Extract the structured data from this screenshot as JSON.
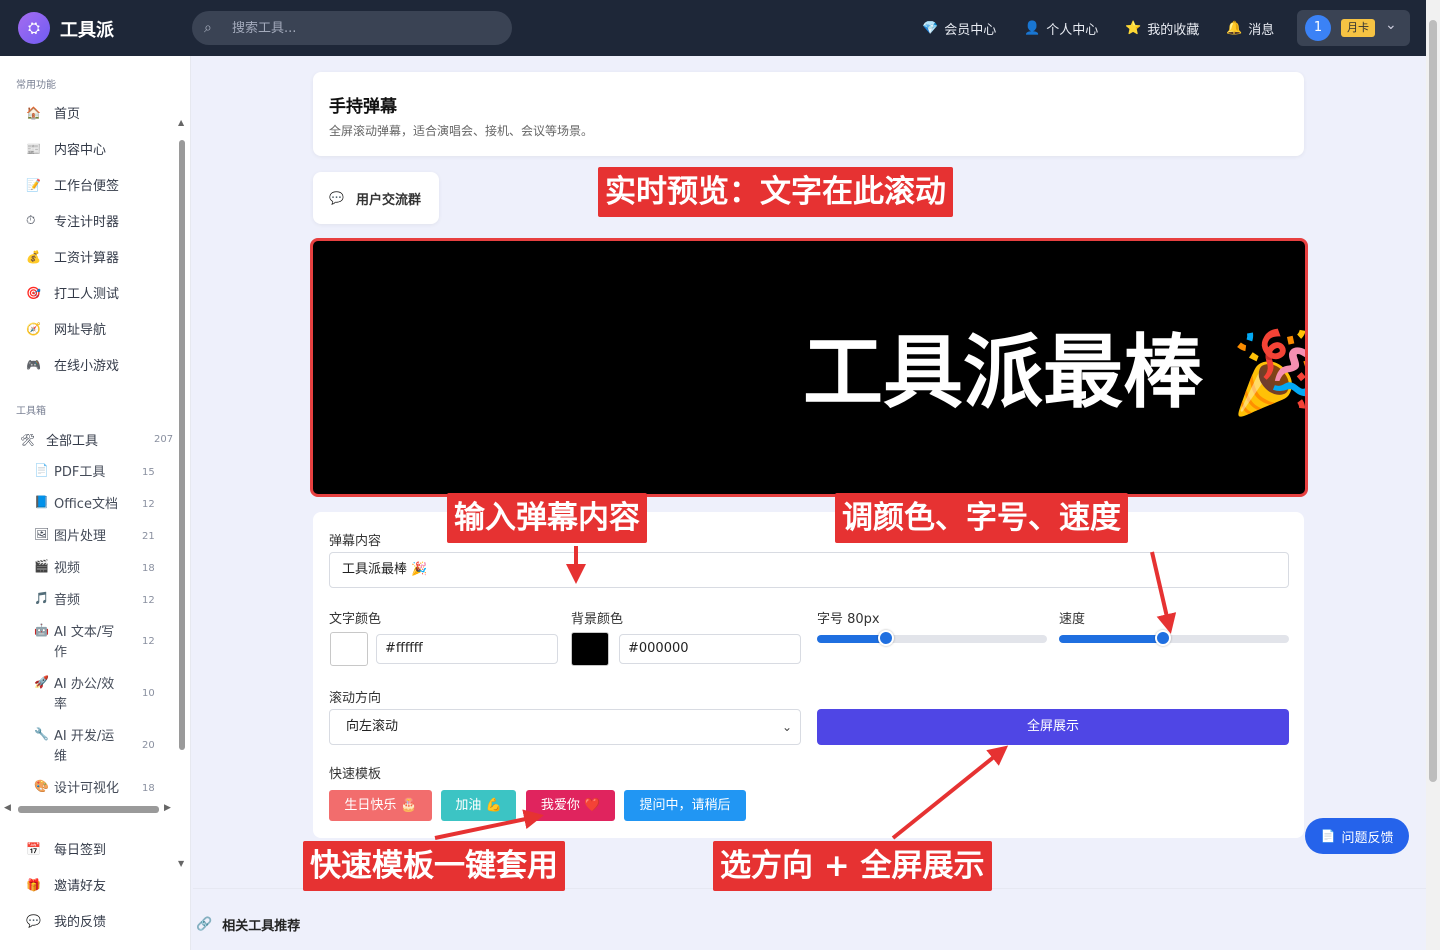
{
  "header": {
    "brand": "工具派",
    "search_placeholder": "搜索工具...",
    "nav": [
      {
        "icon": "💎",
        "label": "会员中心"
      },
      {
        "icon": "👤",
        "label": "个人中心"
      },
      {
        "icon": "⭐",
        "label": "我的收藏"
      },
      {
        "icon": "🔔",
        "label": "消息"
      }
    ],
    "user": {
      "avatar": "1",
      "badge": "月卡",
      "chevron": "⌄"
    }
  },
  "sidebar": {
    "common_label": "常用功能",
    "common": [
      {
        "icon": "🏠",
        "label": "首页"
      },
      {
        "icon": "📰",
        "label": "内容中心"
      },
      {
        "icon": "📝",
        "label": "工作台便签"
      },
      {
        "icon": "⏱",
        "label": "专注计时器"
      },
      {
        "icon": "💰",
        "label": "工资计算器"
      },
      {
        "icon": "🎯",
        "label": "打工人测试"
      },
      {
        "icon": "🧭",
        "label": "网址导航"
      },
      {
        "icon": "🎮",
        "label": "在线小游戏"
      }
    ],
    "toolbox_label": "工具箱",
    "all_tools": {
      "icon": "🛠",
      "label": "全部工具",
      "count": "207"
    },
    "categories": [
      {
        "icon": "📄",
        "label": "PDF工具",
        "count": "15"
      },
      {
        "icon": "📘",
        "label": "Office文档",
        "count": "12"
      },
      {
        "icon": "🖼",
        "label": "图片处理",
        "count": "21"
      },
      {
        "icon": "🎬",
        "label": "视频",
        "count": "18"
      },
      {
        "icon": "🎵",
        "label": "音频",
        "count": "12"
      },
      {
        "icon": "🤖",
        "label": "AI 文本/写作",
        "count": "12"
      },
      {
        "icon": "🚀",
        "label": "AI 办公/效率",
        "count": "10"
      },
      {
        "icon": "🔧",
        "label": "AI 开发/运维",
        "count": "20"
      },
      {
        "icon": "🎨",
        "label": "设计可视化",
        "count": "18"
      }
    ],
    "bottom": [
      {
        "icon": "📅",
        "label": "每日签到"
      },
      {
        "icon": "🎁",
        "label": "邀请好友"
      },
      {
        "icon": "💬",
        "label": "我的反馈"
      }
    ]
  },
  "page": {
    "title": "手持弹幕",
    "description": "全屏滚动弹幕，适合演唱会、接机、会议等场景。",
    "group_button": {
      "icon": "💬",
      "label": "用户交流群"
    },
    "preview_text": "工具派最棒 🎉"
  },
  "form": {
    "content_label": "弹幕内容",
    "content_value": "工具派最棒 🎉",
    "text_color_label": "文字颜色",
    "text_color": "#ffffff",
    "bg_color_label": "背景颜色",
    "bg_color": "#000000",
    "font_size_label": "字号 80px",
    "font_size_level": 0.3,
    "speed_label": "速度",
    "speed_level": 0.45,
    "direction_label": "滚动方向",
    "direction_value": "向左滚动",
    "fullscreen_button": "全屏展示",
    "templates_label": "快速模板",
    "templates": [
      {
        "label": "生日快乐 🎂",
        "color": "#f26d6d"
      },
      {
        "label": "加油 💪",
        "color": "#3cc4c4"
      },
      {
        "label": "我爱你 ❤️",
        "color": "#e0245e"
      },
      {
        "label": "提问中，请稍后",
        "color": "#2196f3"
      }
    ]
  },
  "annotations": {
    "preview": "实时预览：文字在此滚动",
    "input": "输入弹幕内容",
    "style": "调颜色、字号、速度",
    "templates": "快速模板一键套用",
    "direction": "选方向 + 全屏展示"
  },
  "feedback_button": {
    "icon": "📄",
    "label": "问题反馈"
  },
  "related": {
    "icon": "🔗",
    "label": "相关工具推荐"
  },
  "colors": {
    "accent": "#4f46e5",
    "annotation": "#e63232",
    "topbar": "#1e2738"
  }
}
